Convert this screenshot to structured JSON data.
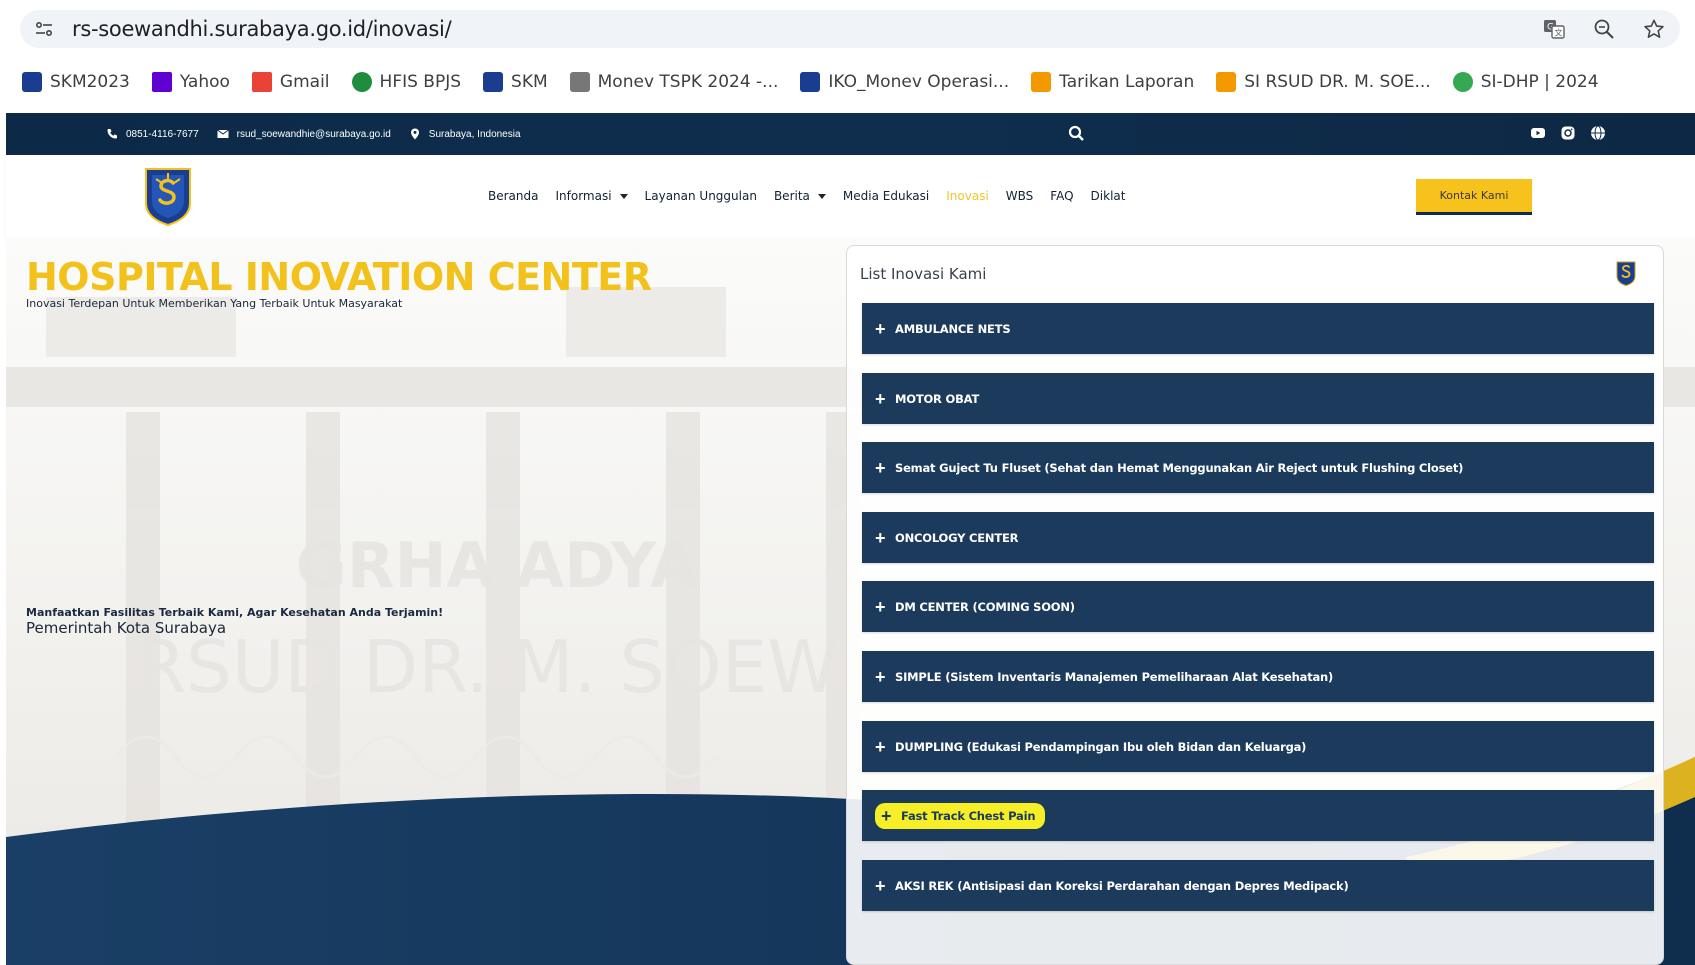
{
  "browser": {
    "url": "rs-soewandhi.surabaya.go.id/inovasi/",
    "bookmarks": [
      {
        "label": "SKM2023",
        "icon": "surabaya-crest-icon",
        "color": "#1a3d8f"
      },
      {
        "label": "Yahoo",
        "icon": "mail-icon",
        "color": "#6001d2"
      },
      {
        "label": "Gmail",
        "icon": "gmail-icon",
        "color": "#ea4335"
      },
      {
        "label": "HFIS BPJS",
        "icon": "gear-icon",
        "color": "#1e8e3e"
      },
      {
        "label": "SKM",
        "icon": "surabaya-crest-icon",
        "color": "#1a3d8f"
      },
      {
        "label": "Monev TSPK 2024 -...",
        "icon": "surabaya-crest-icon",
        "color": "#777777"
      },
      {
        "label": "IKO_Monev Operasi...",
        "icon": "surabaya-crest-icon",
        "color": "#1a3d8f"
      },
      {
        "label": "Tarikan Laporan",
        "icon": "grid-icon",
        "color": "#f29900"
      },
      {
        "label": "SI RSUD DR. M. SOE...",
        "icon": "grid-icon",
        "color": "#f29900"
      },
      {
        "label": "SI-DHP | 2024",
        "icon": "leaf-icon",
        "color": "#34a853"
      }
    ]
  },
  "topbar": {
    "phone": "0851-4116-7677",
    "email": "rsud_soewandhie@surabaya.go.id",
    "location": "Surabaya, Indonesia"
  },
  "nav": {
    "items": [
      {
        "label": "Beranda",
        "dropdown": false,
        "active": false
      },
      {
        "label": "Informasi",
        "dropdown": true,
        "active": false
      },
      {
        "label": "Layanan Unggulan",
        "dropdown": false,
        "active": false
      },
      {
        "label": "Berita",
        "dropdown": true,
        "active": false
      },
      {
        "label": "Media Edukasi",
        "dropdown": false,
        "active": false
      },
      {
        "label": "Inovasi",
        "dropdown": false,
        "active": true
      },
      {
        "label": "WBS",
        "dropdown": false,
        "active": false
      },
      {
        "label": "FAQ",
        "dropdown": false,
        "active": false
      },
      {
        "label": "Diklat",
        "dropdown": false,
        "active": false
      }
    ],
    "contact_button": "Kontak Kami"
  },
  "hero": {
    "title": "HOSPITAL INOVATION CENTER",
    "subtitle": "Inovasi Terdepan Untuk Memberikan Yang Terbaik Untuk Masyarakat",
    "cta_title": "Manfaatkan Fasilitas Terbaik Kami, Agar Kesehatan Anda Terjamin!",
    "cta_sub": "Pemerintah Kota Surabaya"
  },
  "panel": {
    "title": "List Inovasi Kami",
    "items": [
      {
        "label": "AMBULANCE NETS",
        "highlighted": false
      },
      {
        "label": "MOTOR OBAT",
        "highlighted": false
      },
      {
        "label": "Semat Guject Tu Fluset (Sehat dan Hemat Menggunakan Air Reject untuk Flushing Closet)",
        "highlighted": false
      },
      {
        "label": "ONCOLOGY CENTER",
        "highlighted": false
      },
      {
        "label": "DM CENTER (COMING SOON)",
        "highlighted": false
      },
      {
        "label": "SIMPLE (Sistem Inventaris Manajemen Pemeliharaan Alat Kesehatan)",
        "highlighted": false
      },
      {
        "label": "DUMPLING (Edukasi Pendampingan Ibu oleh Bidan dan Keluarga)",
        "highlighted": false
      },
      {
        "label": "Fast Track Chest Pain",
        "highlighted": true
      },
      {
        "label": "AKSI REK (Antisipasi dan Koreksi Perdarahan dengan Depres Medipack)",
        "highlighted": false
      }
    ]
  },
  "colors": {
    "brand_navy": "#0f2e4e",
    "brand_yellow": "#f3c11c",
    "accordion": "#1c3a5c",
    "highlight": "#f6ef28"
  }
}
